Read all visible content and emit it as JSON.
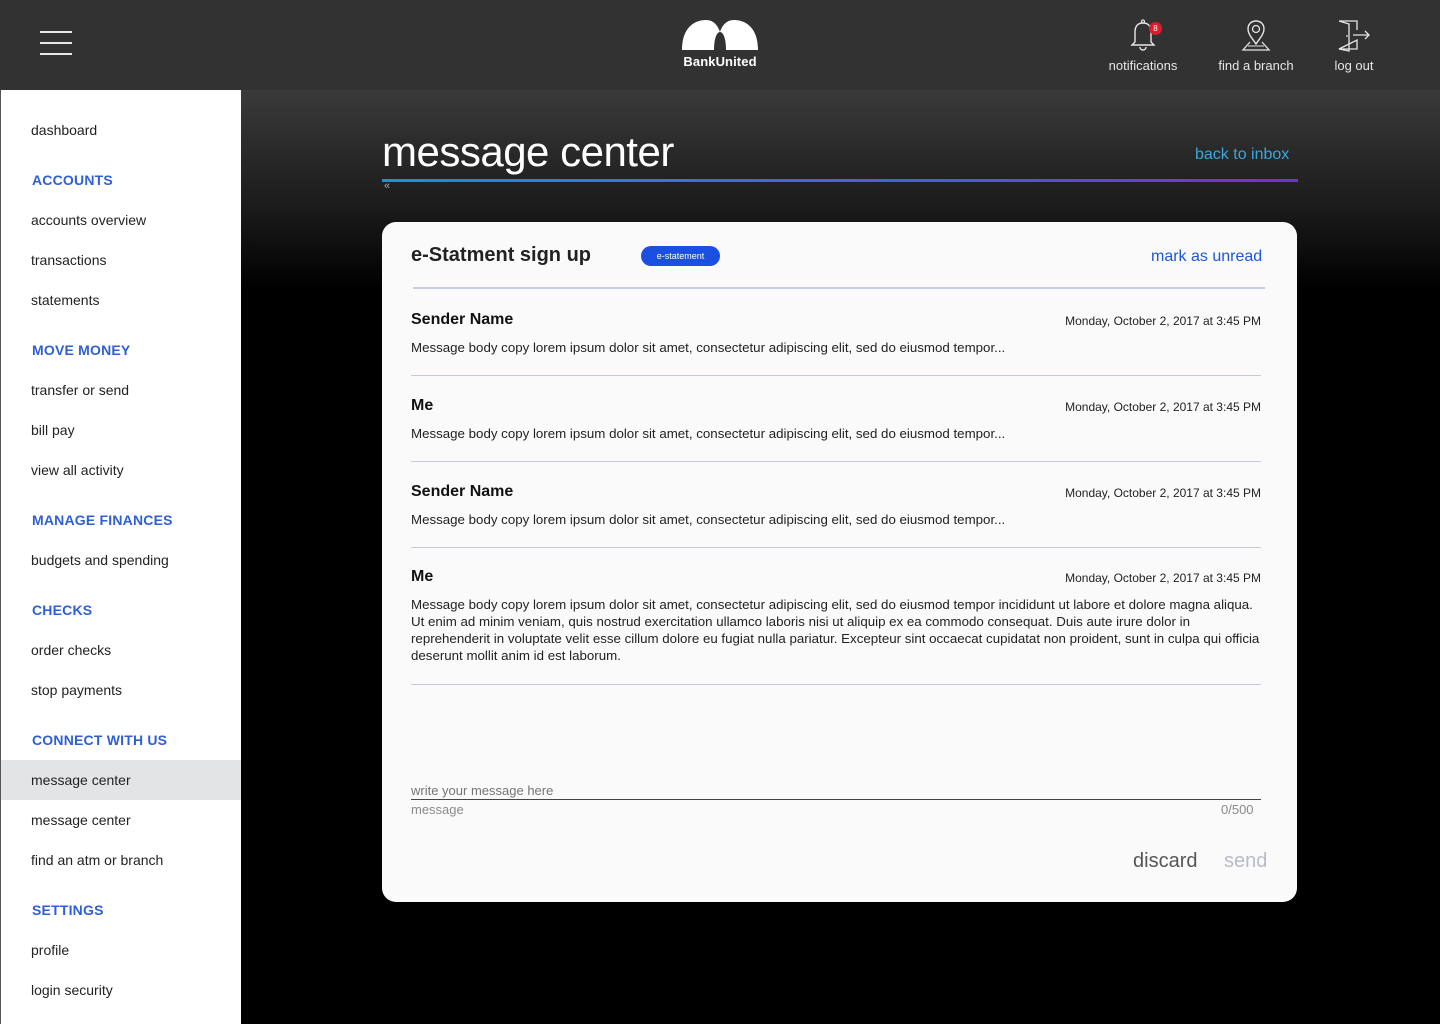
{
  "header": {
    "brand": "BankUnited",
    "notifications_label": "notifications",
    "notifications_count": "8",
    "find_branch_label": "find a branch",
    "logout_label": "log out"
  },
  "sidebar": {
    "items": [
      {
        "label": "dashboard",
        "type": "link"
      },
      {
        "label": "ACCOUNTS",
        "type": "heading"
      },
      {
        "label": "accounts overview",
        "type": "link"
      },
      {
        "label": "transactions",
        "type": "link"
      },
      {
        "label": "statements",
        "type": "link"
      },
      {
        "label": "MOVE MONEY",
        "type": "heading"
      },
      {
        "label": "transfer or send",
        "type": "link"
      },
      {
        "label": "bill pay",
        "type": "link"
      },
      {
        "label": "view all activity",
        "type": "link"
      },
      {
        "label": "MANAGE FINANCES",
        "type": "heading"
      },
      {
        "label": "budgets and spending",
        "type": "link"
      },
      {
        "label": "CHECKS",
        "type": "heading"
      },
      {
        "label": "order checks",
        "type": "link"
      },
      {
        "label": "stop payments",
        "type": "link"
      },
      {
        "label": "CONNECT WITH US",
        "type": "heading"
      },
      {
        "label": "message center",
        "type": "link",
        "active": true
      },
      {
        "label": "message center",
        "type": "link"
      },
      {
        "label": "find an atm or branch",
        "type": "link"
      },
      {
        "label": "SETTINGS",
        "type": "heading"
      },
      {
        "label": "profile",
        "type": "link"
      },
      {
        "label": "login security",
        "type": "link"
      }
    ]
  },
  "page": {
    "title": "message center",
    "back_link": "back to inbox",
    "chevron": "«"
  },
  "thread": {
    "subject": "e-Statment sign up",
    "tag": "e-statement",
    "mark_unread": "mark as unread",
    "messages": [
      {
        "sender": "Sender Name",
        "date": "Monday, October 2, 2017 at 3:45 PM",
        "body": "Message body copy lorem ipsum dolor sit amet, consectetur adipiscing elit, sed do eiusmod tempor..."
      },
      {
        "sender": "Me",
        "date": "Monday, October 2, 2017 at 3:45 PM",
        "body": "Message body copy lorem ipsum dolor sit amet, consectetur adipiscing elit, sed do eiusmod tempor..."
      },
      {
        "sender": "Sender Name",
        "date": "Monday, October 2, 2017 at 3:45 PM",
        "body": "Message body copy lorem ipsum dolor sit amet, consectetur adipiscing elit, sed do eiusmod tempor..."
      },
      {
        "sender": "Me",
        "date": "Monday, October 2, 2017 at 3:45 PM",
        "body": "Message body copy lorem ipsum dolor sit amet, consectetur adipiscing elit, sed do eiusmod tempor incididunt ut labore et dolore magna aliqua. Ut enim ad minim veniam, quis nostrud exercitation ullamco laboris nisi ut aliquip ex ea commodo consequat. Duis aute irure dolor in reprehenderit in voluptate velit esse cillum dolore eu fugiat nulla pariatur. Excepteur sint occaecat cupidatat non proident, sunt in culpa qui officia deserunt mollit anim id est laborum."
      }
    ]
  },
  "compose": {
    "placeholder": "write your message here",
    "label": "message",
    "counter": "0/500",
    "discard_label": "discard",
    "send_label": "send"
  },
  "colors": {
    "accent_blue": "#1f55d8",
    "heading_blue": "#2f5fd7",
    "link_cyan": "#39a8e0",
    "tag_blue": "#1b4fe0",
    "badge_red": "#e01b2d",
    "header_bg": "#333233"
  },
  "icons": {
    "menu": "hamburger-icon",
    "logo": "bankunited-logo",
    "notifications": "bell-icon",
    "branch": "map-pin-icon",
    "logout": "door-exit-icon"
  }
}
